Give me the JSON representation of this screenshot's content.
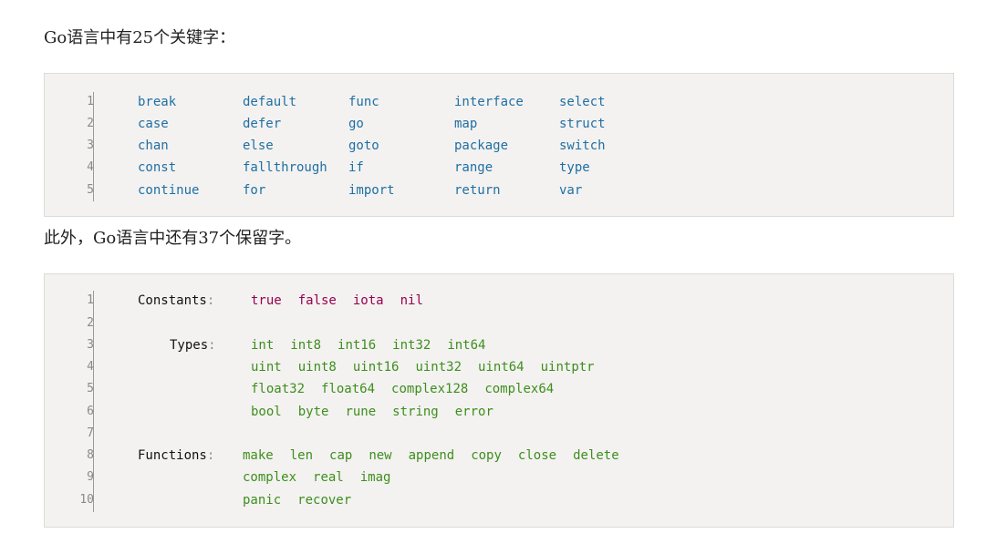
{
  "intro_text": "Go语言中有25个关键字：",
  "reserved_text": "此外，Go语言中还有37个保留字。",
  "keywords_block": {
    "line_numbers": [
      "1",
      "2",
      "3",
      "4",
      "5"
    ],
    "columns": [
      [
        "break",
        "case",
        "chan",
        "const",
        "continue"
      ],
      [
        "default",
        "defer",
        "else",
        "fallthrough",
        "for"
      ],
      [
        "func",
        "go",
        "goto",
        "if",
        "import"
      ],
      [
        "interface",
        "map",
        "package",
        "range",
        "return"
      ],
      [
        "select",
        "struct",
        "switch",
        "type",
        "var"
      ]
    ]
  },
  "reserved_block": {
    "line_numbers": [
      "1",
      "2",
      "3",
      "4",
      "5",
      "6",
      "7",
      "8",
      "9",
      "10"
    ],
    "constants_label": "Constants",
    "types_label": "Types",
    "functions_label": "Functions",
    "colon": ":",
    "constants": [
      "true",
      "false",
      "iota",
      "nil"
    ],
    "types": [
      [
        "int",
        "int8",
        "int16",
        "int32",
        "int64"
      ],
      [
        "uint",
        "uint8",
        "uint16",
        "uint32",
        "uint64",
        "uintptr"
      ],
      [
        "float32",
        "float64",
        "complex128",
        "complex64"
      ],
      [
        "bool",
        "byte",
        "rune",
        "string",
        "error"
      ]
    ],
    "functions": [
      [
        "make",
        "len",
        "cap",
        "new",
        "append",
        "copy",
        "close",
        "delete"
      ],
      [
        "complex",
        "real",
        "imag"
      ],
      [
        "panic",
        "recover"
      ]
    ]
  }
}
